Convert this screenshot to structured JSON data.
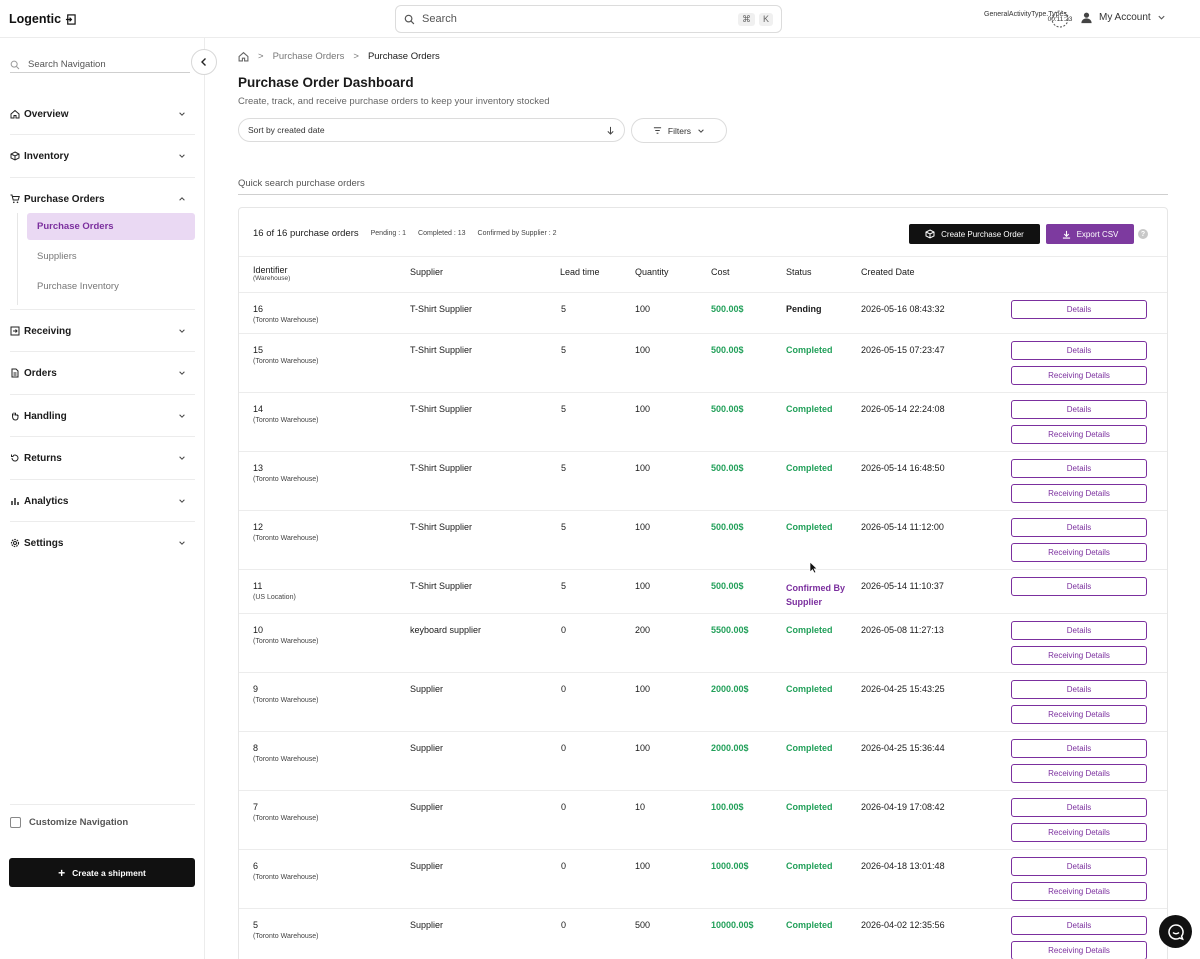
{
  "app": {
    "logo": "Logentic",
    "search_placeholder": "Search",
    "search_keys": [
      "⌘",
      "K"
    ],
    "activity_label": "GeneralActivityType.Types.",
    "timer": "00:11:23",
    "account_label": "My Account"
  },
  "sidebar": {
    "search_placeholder": "Search Navigation",
    "items": [
      {
        "label": "Overview",
        "icon": "home-icon"
      },
      {
        "label": "Inventory",
        "icon": "box-icon"
      },
      {
        "label": "Purchase Orders",
        "icon": "cart-icon",
        "expanded": true
      },
      {
        "label": "Receiving",
        "icon": "receive-icon"
      },
      {
        "label": "Orders",
        "icon": "document-icon"
      },
      {
        "label": "Handling",
        "icon": "hand-icon"
      },
      {
        "label": "Returns",
        "icon": "return-icon"
      },
      {
        "label": "Analytics",
        "icon": "bar-chart-icon"
      },
      {
        "label": "Settings",
        "icon": "gear-icon"
      }
    ],
    "sub_items": [
      {
        "label": "Purchase Orders",
        "active": true
      },
      {
        "label": "Suppliers",
        "active": false
      },
      {
        "label": "Purchase Inventory",
        "active": false
      }
    ],
    "customize_label": "Customize Navigation",
    "create_shipment_label": "Create a shipment"
  },
  "breadcrumb": [
    "Purchase Orders",
    "Purchase Orders"
  ],
  "page": {
    "title": "Purchase Order Dashboard",
    "subtitle": "Create, track, and receive purchase orders to keep your inventory stocked",
    "sort_label": "Sort by created date",
    "filters_label": "Filters",
    "quick_search_placeholder": "Quick search purchase orders"
  },
  "summary": {
    "count_text": "16 of 16 purchase orders",
    "pending": "Pending : 1",
    "completed": "Completed : 13",
    "confirmed": "Confirmed by Supplier : 2",
    "create_label": "Create Purchase Order",
    "export_label": "Export CSV",
    "help": "?"
  },
  "table": {
    "headers": {
      "identifier": "Identifier",
      "identifier_sub": "(Warehouse)",
      "supplier": "Supplier",
      "lead_time": "Lead time",
      "quantity": "Quantity",
      "cost": "Cost",
      "status": "Status",
      "created": "Created Date"
    },
    "details_label": "Details",
    "receiving_label": "Receiving Details",
    "rows": [
      {
        "id": "16",
        "warehouse": "(Toronto Warehouse)",
        "supplier": "T-Shirt Supplier",
        "lead": "5",
        "qty": "100",
        "cost": "500.00$",
        "status": "Pending",
        "status_key": "pending",
        "date": "2026-05-16 08:43:32",
        "receiving": false
      },
      {
        "id": "15",
        "warehouse": "(Toronto Warehouse)",
        "supplier": "T-Shirt Supplier",
        "lead": "5",
        "qty": "100",
        "cost": "500.00$",
        "status": "Completed",
        "status_key": "completed",
        "date": "2026-05-15 07:23:47",
        "receiving": true
      },
      {
        "id": "14",
        "warehouse": "(Toronto Warehouse)",
        "supplier": "T-Shirt Supplier",
        "lead": "5",
        "qty": "100",
        "cost": "500.00$",
        "status": "Completed",
        "status_key": "completed",
        "date": "2026-05-14 22:24:08",
        "receiving": true
      },
      {
        "id": "13",
        "warehouse": "(Toronto Warehouse)",
        "supplier": "T-Shirt Supplier",
        "lead": "5",
        "qty": "100",
        "cost": "500.00$",
        "status": "Completed",
        "status_key": "completed",
        "date": "2026-05-14 16:48:50",
        "receiving": true
      },
      {
        "id": "12",
        "warehouse": "(Toronto Warehouse)",
        "supplier": "T-Shirt Supplier",
        "lead": "5",
        "qty": "100",
        "cost": "500.00$",
        "status": "Completed",
        "status_key": "completed",
        "date": "2026-05-14 11:12:00",
        "receiving": true
      },
      {
        "id": "11",
        "warehouse": "(US Location)",
        "supplier": "T-Shirt Supplier",
        "lead": "5",
        "qty": "100",
        "cost": "500.00$",
        "status": "Confirmed By Supplier",
        "status_key": "confirmed",
        "date": "2026-05-14 11:10:37",
        "receiving": false
      },
      {
        "id": "10",
        "warehouse": "(Toronto Warehouse)",
        "supplier": "keyboard supplier",
        "lead": "0",
        "qty": "200",
        "cost": "5500.00$",
        "status": "Completed",
        "status_key": "completed",
        "date": "2026-05-08 11:27:13",
        "receiving": true
      },
      {
        "id": "9",
        "warehouse": "(Toronto Warehouse)",
        "supplier": "Supplier",
        "lead": "0",
        "qty": "100",
        "cost": "2000.00$",
        "status": "Completed",
        "status_key": "completed",
        "date": "2026-04-25 15:43:25",
        "receiving": true
      },
      {
        "id": "8",
        "warehouse": "(Toronto Warehouse)",
        "supplier": "Supplier",
        "lead": "0",
        "qty": "100",
        "cost": "2000.00$",
        "status": "Completed",
        "status_key": "completed",
        "date": "2026-04-25 15:36:44",
        "receiving": true
      },
      {
        "id": "7",
        "warehouse": "(Toronto Warehouse)",
        "supplier": "Supplier",
        "lead": "0",
        "qty": "10",
        "cost": "100.00$",
        "status": "Completed",
        "status_key": "completed",
        "date": "2026-04-19 17:08:42",
        "receiving": true
      },
      {
        "id": "6",
        "warehouse": "(Toronto Warehouse)",
        "supplier": "Supplier",
        "lead": "0",
        "qty": "100",
        "cost": "1000.00$",
        "status": "Completed",
        "status_key": "completed",
        "date": "2026-04-18 13:01:48",
        "receiving": true
      },
      {
        "id": "5",
        "warehouse": "(Toronto Warehouse)",
        "supplier": "Supplier",
        "lead": "0",
        "qty": "500",
        "cost": "10000.00$",
        "status": "Completed",
        "status_key": "completed",
        "date": "2026-04-02 12:35:56",
        "receiving": true
      }
    ]
  },
  "colors": {
    "accent": "#7d3a9f",
    "completed": "#22a05a",
    "active_bg": "#ead9f3"
  }
}
